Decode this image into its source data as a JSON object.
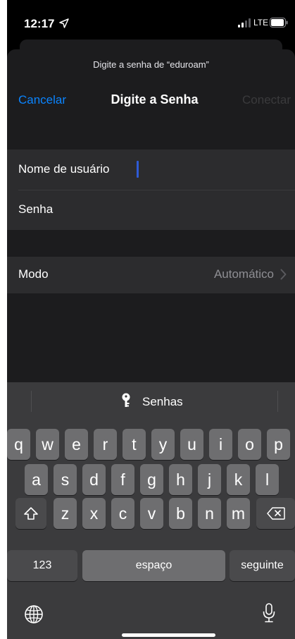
{
  "status_bar": {
    "time": "12:17",
    "network": "LTE"
  },
  "sheet": {
    "prompt": "Digite a senha de “eduroam”",
    "cancel_label": "Cancelar",
    "title": "Digite a Senha",
    "connect_label": "Conectar"
  },
  "form": {
    "username_label": "Nome de usuário",
    "password_label": "Senha",
    "mode_label": "Modo",
    "mode_value": "Automático"
  },
  "keyboard": {
    "suggestion": "Senhas",
    "row1": [
      "q",
      "w",
      "e",
      "r",
      "t",
      "y",
      "u",
      "i",
      "o",
      "p"
    ],
    "row2": [
      "a",
      "s",
      "d",
      "f",
      "g",
      "h",
      "j",
      "k",
      "l"
    ],
    "row3": [
      "z",
      "x",
      "c",
      "v",
      "b",
      "n",
      "m"
    ],
    "numbers_label": "123",
    "space_label": "espaço",
    "return_label": "seguinte"
  },
  "colors": {
    "accent": "#0a84ff",
    "sheet_bg": "#1c1c1e",
    "cell_bg": "#2c2c2e",
    "keyboard_bg": "#3b3b3d",
    "key_bg": "#6e6e70"
  }
}
